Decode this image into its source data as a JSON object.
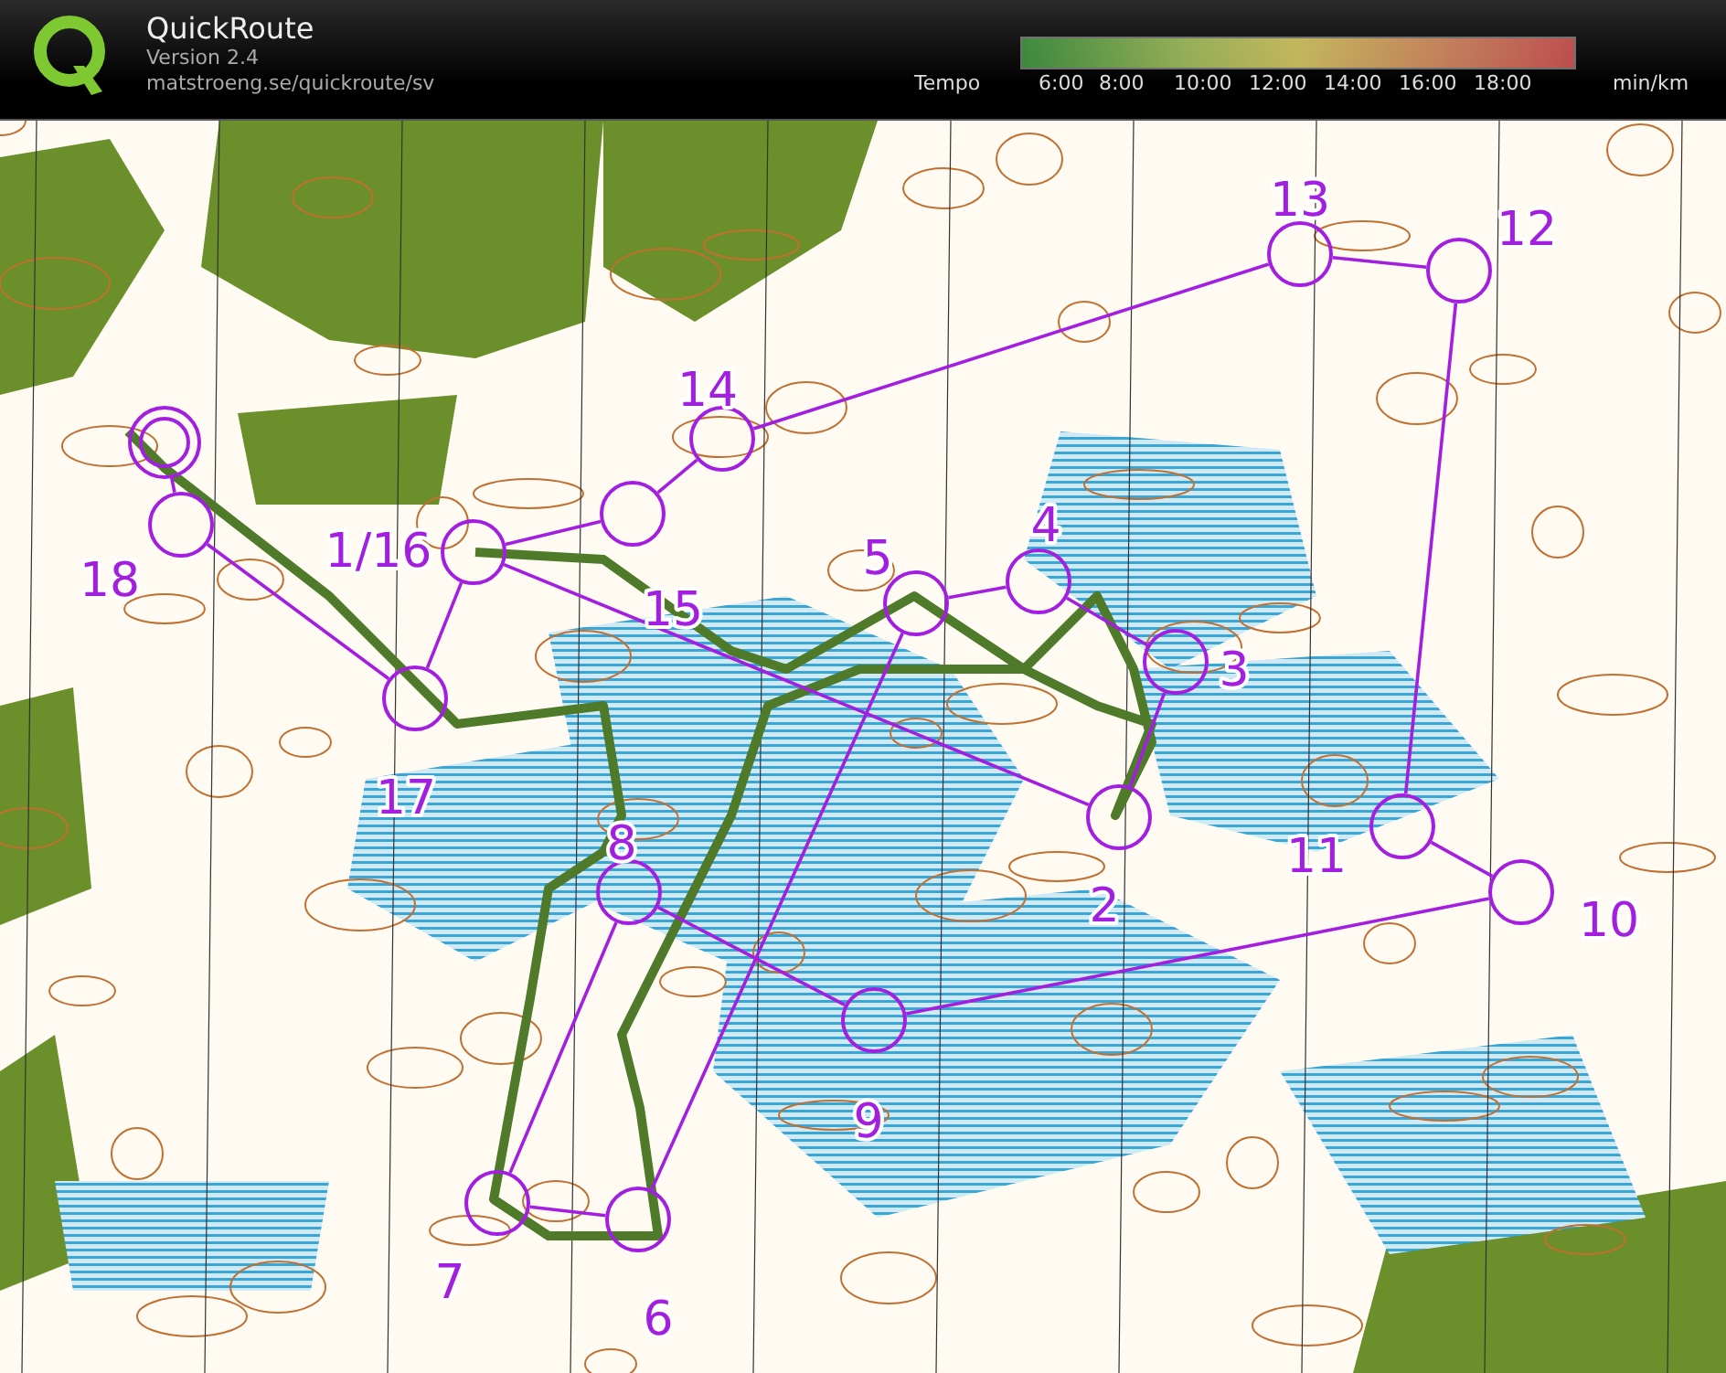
{
  "app": {
    "title": "QuickRoute",
    "version": "Version 2.4",
    "url": "matstroeng.se/quickroute/sv"
  },
  "legend": {
    "label": "Tempo",
    "ticks": [
      "6:00",
      "8:00",
      "10:00",
      "12:00",
      "14:00",
      "16:00",
      "18:00"
    ],
    "unit": "min/km"
  },
  "map": {
    "controls": [
      {
        "label": "1/16"
      },
      {
        "label": "2"
      },
      {
        "label": "3"
      },
      {
        "label": "4"
      },
      {
        "label": "5"
      },
      {
        "label": "6"
      },
      {
        "label": "7"
      },
      {
        "label": "8"
      },
      {
        "label": "9"
      },
      {
        "label": "10"
      },
      {
        "label": "11"
      },
      {
        "label": "12"
      },
      {
        "label": "13"
      },
      {
        "label": "14"
      },
      {
        "label": "15"
      },
      {
        "label": "17"
      },
      {
        "label": "18"
      }
    ]
  }
}
